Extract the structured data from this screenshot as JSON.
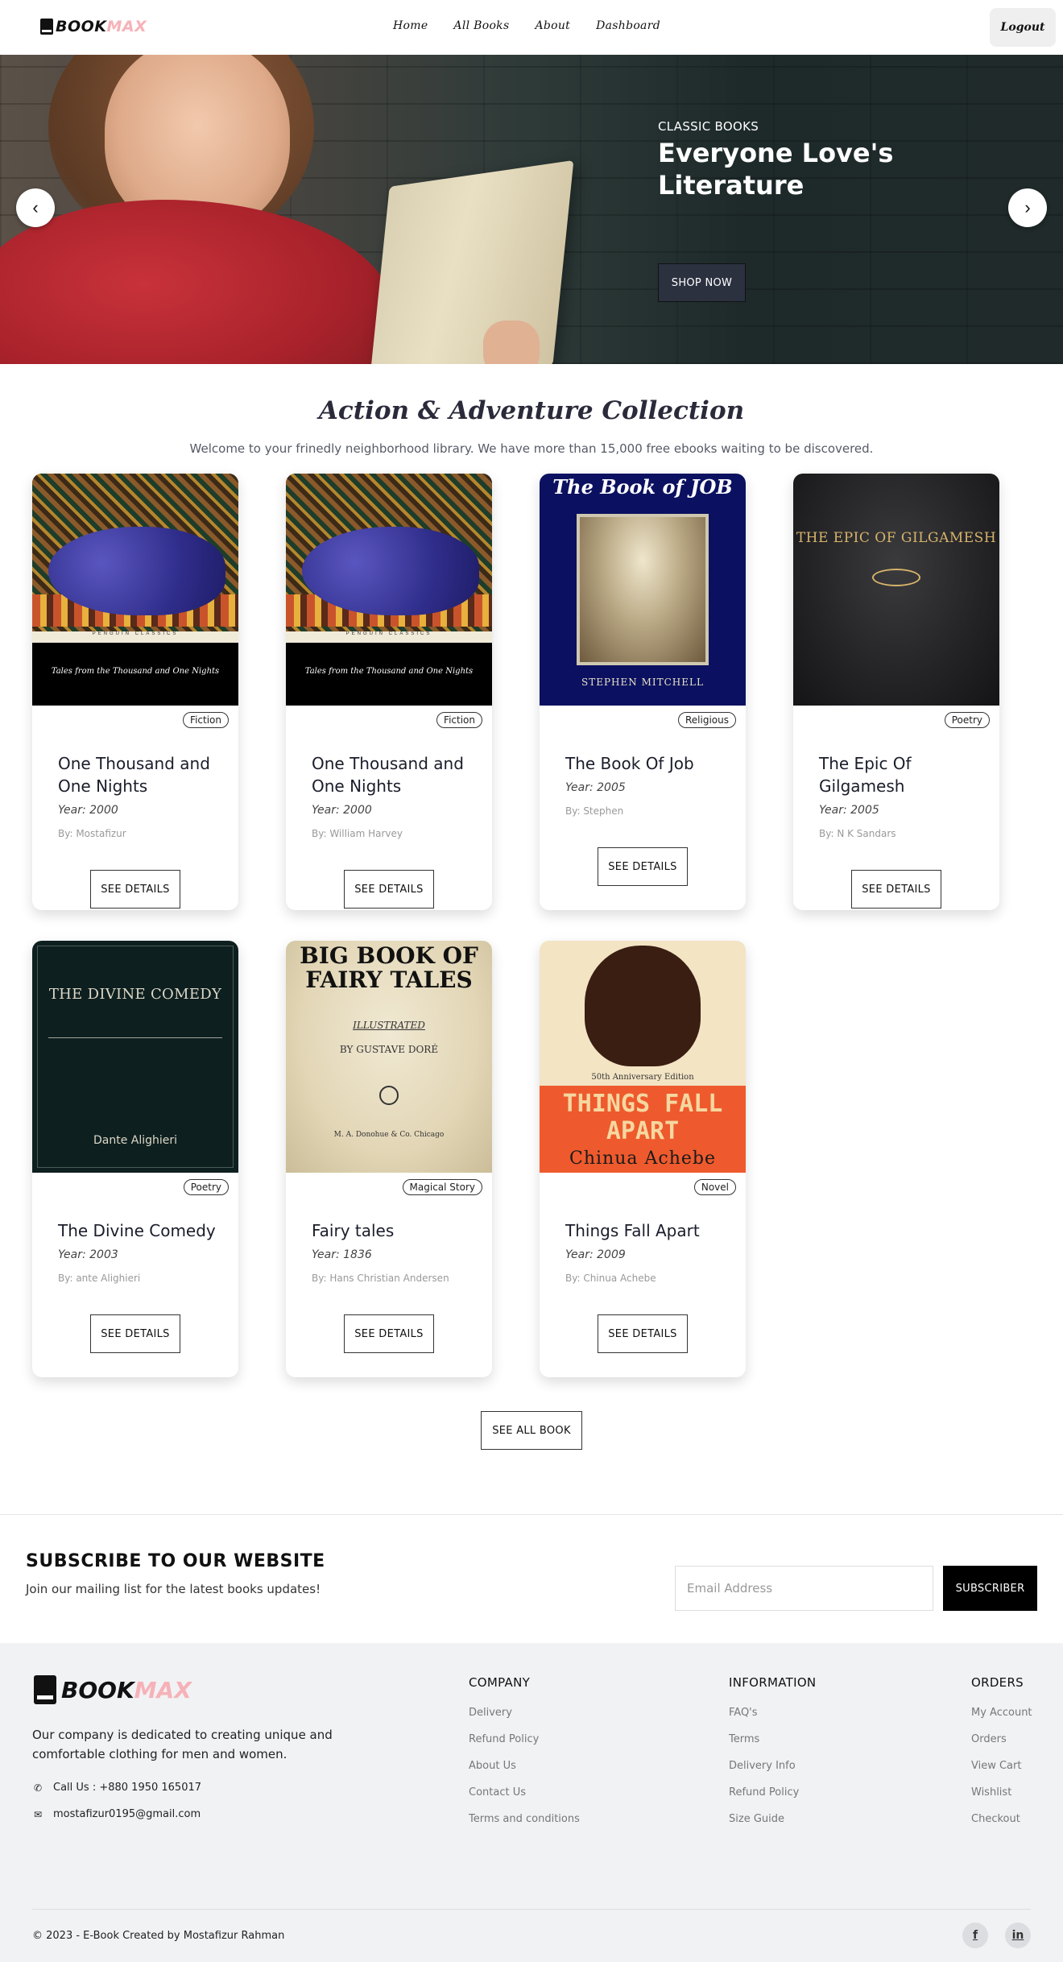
{
  "nav": {
    "logo_part1": "BOOK",
    "logo_part2": "MAX",
    "links": [
      "Home",
      "All Books",
      "About",
      "Dashboard"
    ],
    "logout_label": "Logout"
  },
  "hero": {
    "subtitle": "CLASSIC BOOKS",
    "title": "Everyone Love's Literature",
    "button_label": "SHOP NOW",
    "prev_arrow": "‹",
    "next_arrow": "›"
  },
  "collection": {
    "title": "Action & Adventure Collection",
    "subtitle": "Welcome to your frinedly neighborhood library. We have more than 15,000 free ebooks waiting to be discovered.",
    "details_label": "SEE DETAILS",
    "see_all_label": "SEE ALL BOOK",
    "books": [
      {
        "title": "One Thousand and One Nights",
        "category": "Fiction",
        "year": "Year: 2000",
        "author": "By: Mostafizur",
        "cover_text": "Tales from the Thousand and One Nights",
        "cover_band": "PENGUIN CLASSICS"
      },
      {
        "title": "One Thousand and One Nights",
        "category": "Fiction",
        "year": "Year: 2000",
        "author": "By: William Harvey",
        "cover_text": "Tales from the Thousand and One Nights",
        "cover_band": "PENGUIN CLASSICS"
      },
      {
        "title": "The Book Of Job",
        "category": "Religious",
        "year": "Year: 2005",
        "author": "By: Stephen",
        "cover_text": "The Book of JOB",
        "cover_author": "STEPHEN MITCHELL"
      },
      {
        "title": "The Epic Of Gilgamesh",
        "category": "Poetry",
        "year": "Year: 2005",
        "author": "By: N K Sandars",
        "cover_text": "THE EPIC OF GILGAMESH"
      },
      {
        "title": "The Divine Comedy",
        "category": "Poetry",
        "year": "Year: 2003",
        "author": "By: ante Alighieri",
        "cover_text": "THE DIVINE COMEDY",
        "cover_author": "Dante Alighieri"
      },
      {
        "title": "Fairy tales",
        "category": "Magical Story",
        "year": "Year: 1836",
        "author": "By: Hans Christian Andersen",
        "cover_text": "BIG BOOK OF FAIRY TALES",
        "cover_ill": "ILLUSTRATED",
        "cover_by": "BY GUSTAVE DORÉ",
        "cover_pub": "M. A. Donohue & Co. Chicago"
      },
      {
        "title": "Things Fall Apart",
        "category": "Novel",
        "year": "Year: 2009",
        "author": "By: Chinua Achebe",
        "cover_text": "THINGS FALL APART",
        "cover_ann": "50th Anniversary Edition",
        "cover_author": "Chinua Achebe"
      }
    ]
  },
  "subscribe": {
    "title": "SUBSCRIBE TO OUR WEBSITE",
    "text": "Join our mailing list for the latest books updates!",
    "email_placeholder": "Email Address",
    "button_label": "SUBSCRIBER"
  },
  "footer": {
    "logo_part1": "BOOK",
    "logo_part2": "MAX",
    "description": "Our company is dedicated to creating unique and comfortable clothing for men and women.",
    "phone": "Call Us : +880 1950 165017",
    "email": "mostafizur0195@gmail.com",
    "columns": [
      {
        "title": "COMPANY",
        "links": [
          "Delivery",
          "Refund Policy",
          "About Us",
          "Contact Us",
          "Terms and conditions"
        ]
      },
      {
        "title": "INFORMATION",
        "links": [
          "FAQ's",
          "Terms",
          "Delivery Info",
          "Refund Policy",
          "Size Guide"
        ]
      },
      {
        "title": "ORDERS",
        "links": [
          "My Account",
          "Orders",
          "View Cart",
          "Wishlist",
          "Checkout"
        ]
      }
    ],
    "copyright": "© 2023 - E-Book Created by Mostafizur Rahman",
    "social": [
      "f",
      "in"
    ]
  }
}
